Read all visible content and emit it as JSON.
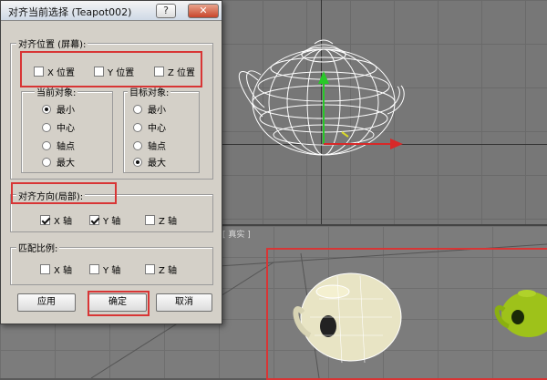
{
  "dialog": {
    "title": "对齐当前选择 (Teapot002)",
    "help_label": "?",
    "close_label": "✕",
    "align_position": {
      "title": "对齐位置 (屏幕):",
      "x_label": "X 位置",
      "y_label": "Y 位置",
      "z_label": "Z 位置",
      "x_checked": false,
      "y_checked": false,
      "z_checked": false
    },
    "current_object": {
      "title": "当前对象:",
      "options": [
        "最小",
        "中心",
        "轴点",
        "最大"
      ],
      "selected": "最小"
    },
    "target_object": {
      "title": "目标对象:",
      "options": [
        "最小",
        "中心",
        "轴点",
        "最大"
      ],
      "selected": "最大"
    },
    "align_orientation": {
      "title": "对齐方向(局部):",
      "x_label": "X 轴",
      "y_label": "Y 轴",
      "z_label": "Z 轴",
      "x_checked": true,
      "y_checked": true,
      "z_checked": false
    },
    "match_scale": {
      "title": "匹配比例:",
      "x_label": "X 轴",
      "y_label": "Y 轴",
      "z_label": "Z 轴",
      "x_checked": false,
      "y_checked": false,
      "z_checked": false
    },
    "apply_label": "应用",
    "ok_label": "确定",
    "cancel_label": "取消"
  },
  "viewport": {
    "bottom_label": "[ 真实 ]"
  },
  "colors": {
    "highlight": "#d83535",
    "dialog_bg": "#d4d0c8",
    "teapot_wire": "#ffffff",
    "teapot_solid": "#e8e4c4",
    "teapot_green": "#9ec21a"
  }
}
